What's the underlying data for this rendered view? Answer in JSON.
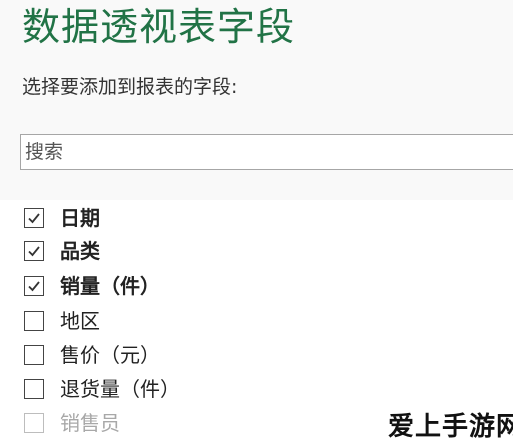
{
  "pane": {
    "title": "数据透视表字段",
    "subtitle": "选择要添加到报表的字段:",
    "search": {
      "placeholder": "搜索",
      "value": ""
    },
    "fields": [
      {
        "label": "日期",
        "checked": true
      },
      {
        "label": "品类",
        "checked": true
      },
      {
        "label": "销量（件）",
        "checked": true
      },
      {
        "label": "地区",
        "checked": false
      },
      {
        "label": "售价（元）",
        "checked": false
      },
      {
        "label": "退货量（件）",
        "checked": false
      },
      {
        "label": "销售员",
        "checked": false
      }
    ]
  },
  "watermark": "爱上手游网",
  "colors": {
    "title_green": "#217346",
    "pane_background": "#f9f9f9",
    "list_background": "#ffffff"
  },
  "icons": {
    "checked": "checkmark-icon"
  }
}
